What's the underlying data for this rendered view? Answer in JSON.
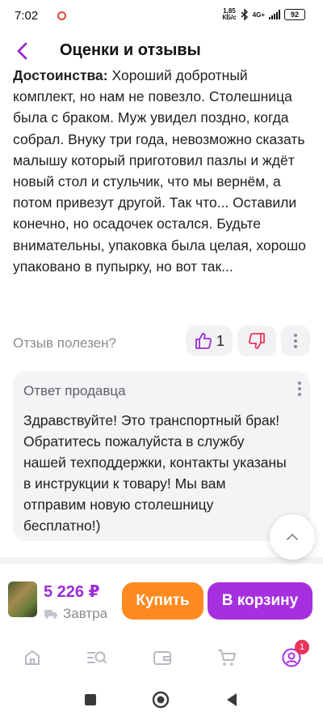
{
  "status_bar": {
    "time": "7:02",
    "net_speed_top": "1,85",
    "net_speed_bottom": "КБ/с",
    "network": "4G+",
    "battery": "92"
  },
  "header": {
    "title": "Оценки и отзывы",
    "back_icon": "chevron-left-icon"
  },
  "review": {
    "label_cut": "Достоинства:",
    "text_cut": " Хороший добротный",
    "text": "комплект, но нам не повезло. Столешница была с браком. Муж увидел поздно, когда собрал. Внуку три года, невозможно сказать малышу который приготовил пазлы и ждёт новый стол и стульчик, что мы вернём, а потом привезут другой. Так что... Оставили конечно, но осадочек остался. Будьте внимательны, упаковка была целая, хорошо упаковано в пупырку, но вот так..."
  },
  "helpful": {
    "label": "Отзыв полезен?",
    "like_count": "1"
  },
  "seller_reply": {
    "title": "Ответ продавца",
    "text": "Здравствуйте! Это транспортный брак! Обратитесь пожалуйста в службу нашей техподдержки, контакты указаны в инструкции к товару! Мы вам отправим новую столешницу бесплатно!)"
  },
  "buy_bar": {
    "price": "5 226 ₽",
    "delivery": "Завтра",
    "buy_label": "Купить",
    "cart_label": "В корзину"
  },
  "tabs": {
    "items": [
      "home-icon",
      "catalog-search-icon",
      "wallet-icon",
      "cart-icon",
      "profile-icon"
    ],
    "profile_badge": "1"
  },
  "colors": {
    "accent": "#a62fe0",
    "price": "#9c2bd6",
    "buy": "#ff8a1f",
    "badge": "#e8345a"
  }
}
